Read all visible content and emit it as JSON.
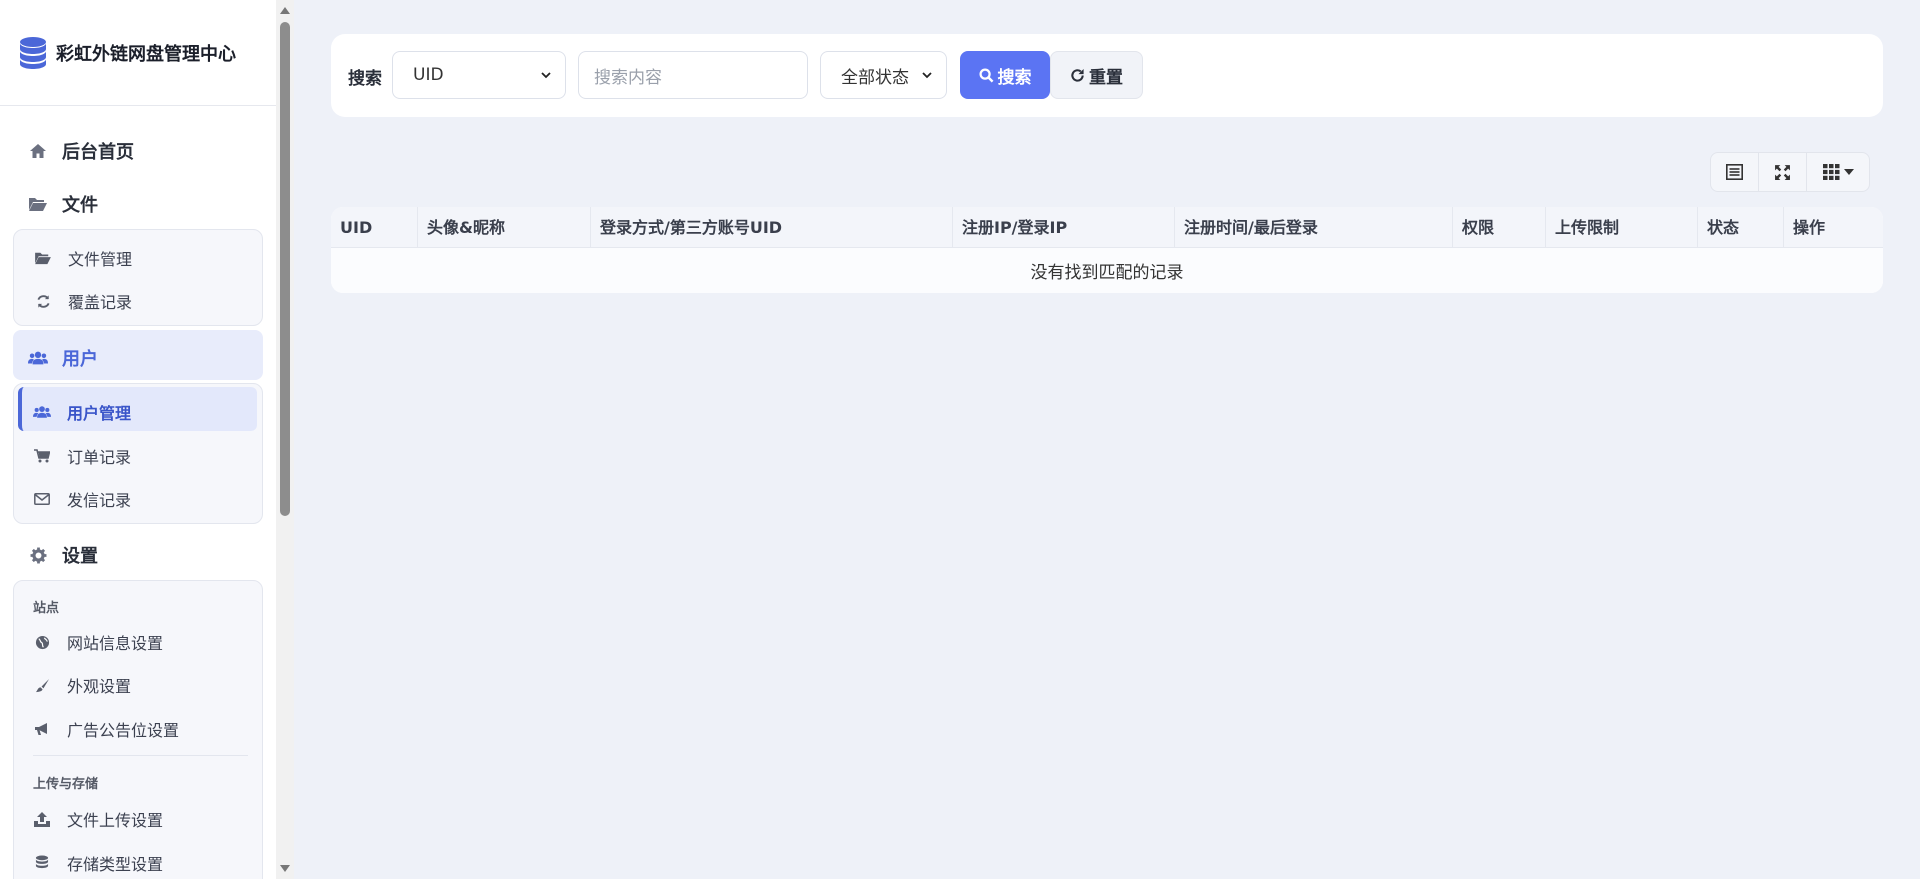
{
  "app": {
    "title": "彩虹外链网盘管理中心"
  },
  "sidebar": {
    "home": "后台首页",
    "files": {
      "label": "文件",
      "items": [
        "文件管理",
        "覆盖记录"
      ]
    },
    "users": {
      "label": "用户",
      "items": [
        "用户管理",
        "订单记录",
        "发信记录"
      ]
    },
    "settings": {
      "label": "设置",
      "group_site": "站点",
      "site_items": [
        "网站信息设置",
        "外观设置",
        "广告公告位设置"
      ],
      "group_upload": "上传与存储",
      "upload_items": [
        "文件上传设置",
        "存储类型设置"
      ]
    }
  },
  "search": {
    "label": "搜索",
    "field_select": "UID",
    "input_placeholder": "搜索内容",
    "status_select": "全部状态",
    "search_button": "搜索",
    "reset_button": "重置"
  },
  "table": {
    "columns": [
      "UID",
      "头像&昵称",
      "登录方式/第三方账号UID",
      "注册IP/登录IP",
      "注册时间/最后登录",
      "权限",
      "上传限制",
      "状态",
      "操作"
    ],
    "empty_text": "没有找到匹配的记录"
  },
  "colors": {
    "accent": "#5b74f3",
    "active_text": "#4b67d8",
    "background": "#eef1f8"
  }
}
